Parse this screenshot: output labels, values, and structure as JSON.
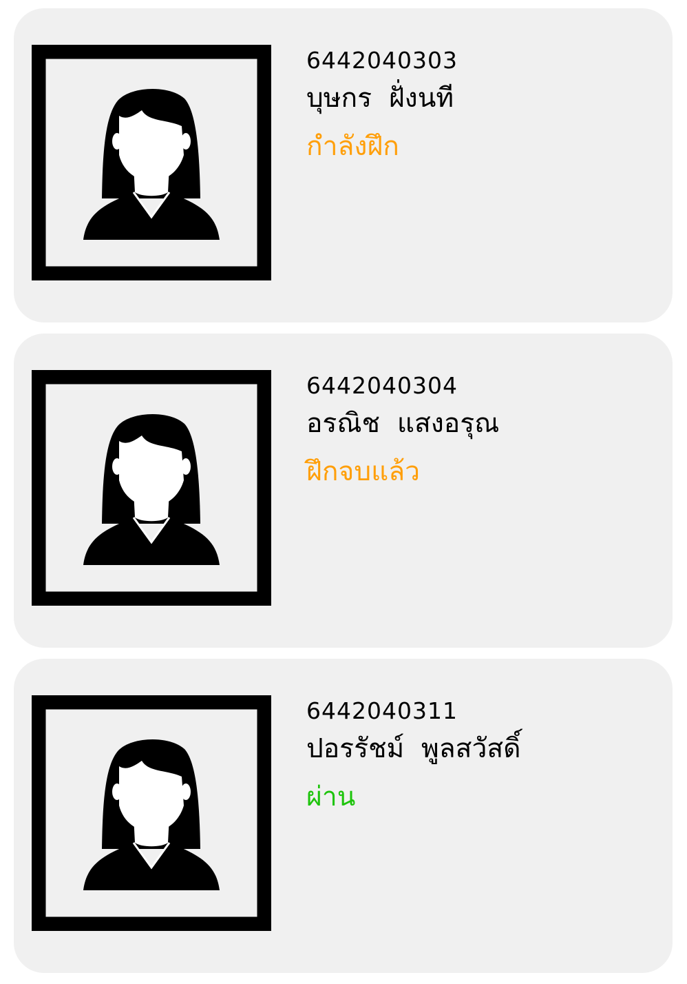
{
  "colors": {
    "card_background": "#f0f0f0",
    "status_in_progress": "#ff9f0a",
    "status_finished": "#ff9f0a",
    "status_passed": "#1ec40c"
  },
  "students": [
    {
      "id": "6442040303",
      "name": "บุษกร  ฝั่งนที",
      "status": "กำลังฝึก",
      "status_color": "#ff9f0a",
      "avatar_icon": "female-avatar-icon"
    },
    {
      "id": "6442040304",
      "name": "อรณิช  แสงอรุณ",
      "status": "ฝึกจบแล้ว",
      "status_color": "#ff9f0a",
      "avatar_icon": "female-avatar-icon"
    },
    {
      "id": "6442040311",
      "name": "ปอรรัชม์  พูลสวัสดิ์",
      "status": "ผ่าน",
      "status_color": "#1ec40c",
      "avatar_icon": "female-avatar-icon"
    }
  ]
}
